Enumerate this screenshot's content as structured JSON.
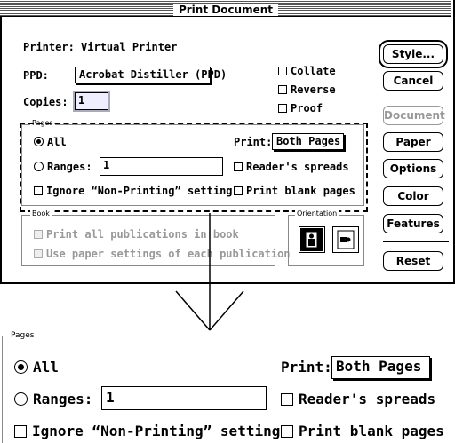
{
  "window": {
    "title": "Print Document"
  },
  "printer": {
    "label": "Printer:",
    "value": "Virtual Printer"
  },
  "ppd": {
    "label": "PPD:",
    "value": "Acrobat Distiller (PPD)"
  },
  "copies": {
    "label": "Copies:",
    "value": "1"
  },
  "options": {
    "collate": "Collate",
    "reverse": "Reverse",
    "proof": "Proof"
  },
  "pages": {
    "group_label": "Pages",
    "all": "All",
    "ranges_label": "Ranges:",
    "ranges_value": "1",
    "ignore": "Ignore “Non-Printing” setting",
    "print_label": "Print:",
    "print_value": "Both Pages",
    "readers": "Reader's spreads",
    "blank": "Print blank pages"
  },
  "book": {
    "group_label": "Book",
    "all_pubs": "Print all publications in book",
    "paper_settings": "Use paper settings of each publication"
  },
  "orientation": {
    "group_label": "Orientation"
  },
  "buttons": {
    "style": "Style...",
    "cancel": "Cancel",
    "document": "Document",
    "paper": "Paper",
    "options": "Options",
    "color": "Color",
    "features": "Features",
    "reset": "Reset"
  }
}
